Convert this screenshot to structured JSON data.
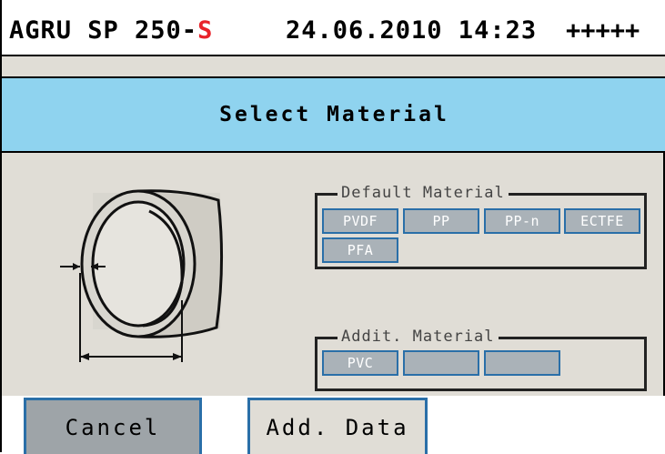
{
  "status": {
    "model": "AGRU SP 250-",
    "model_suffix": "S",
    "datetime": "24.06.2010 14:23",
    "signal": "+++++"
  },
  "title": "Select Material",
  "default_group": {
    "legend": "Default Material",
    "buttons": [
      "PVDF",
      "PP",
      "PP-n",
      "ECTFE",
      "PFA"
    ]
  },
  "addit_group": {
    "legend": "Addit. Material",
    "buttons": [
      "PVC",
      "",
      ""
    ]
  },
  "footer": {
    "cancel_label": "Cancel",
    "add_data_label": "Add. Data"
  },
  "colors": {
    "title_bg": "#8fd3ef",
    "panel_bg": "#e0ddd6",
    "button_bg": "#aab2b8",
    "button_border": "#2a6fa8",
    "model_suffix": "#e8232a"
  },
  "icons": {
    "pipe": "pipe-diagram-icon"
  }
}
